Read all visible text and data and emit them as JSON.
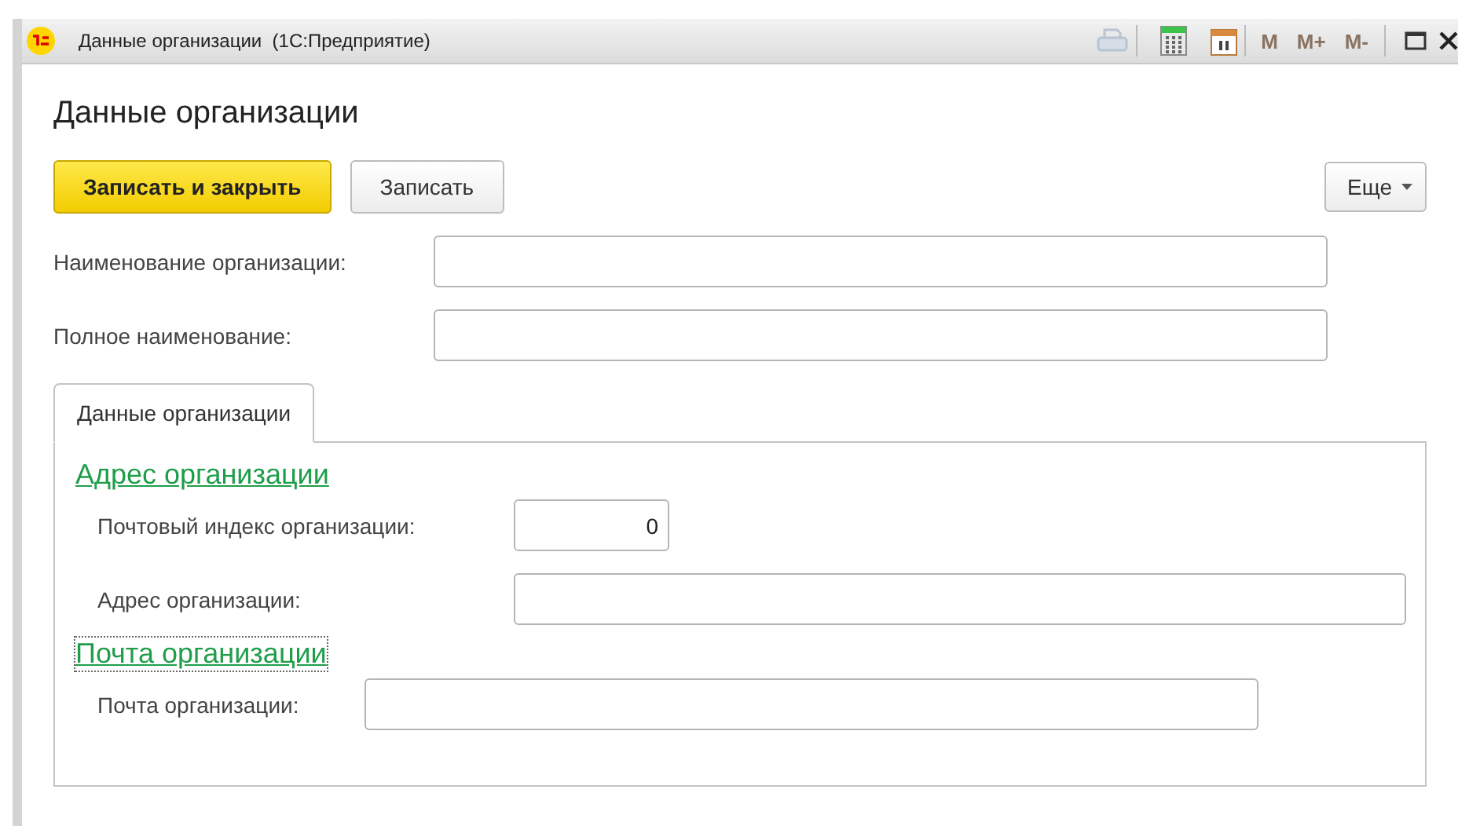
{
  "window": {
    "title": "Данные организации  (1С:Предприятие)",
    "memory_buttons": [
      "M",
      "M+",
      "M-"
    ]
  },
  "form_title": "Данные организации",
  "toolbar": {
    "buttons": [
      {
        "label": "Записать и закрыть",
        "kind": "primary"
      },
      {
        "label": "Записать",
        "kind": "plain"
      }
    ],
    "more": {
      "label": "Еще"
    }
  },
  "fields": [
    {
      "label": "Наименование организации:"
    },
    {
      "label": "Полное наименование:"
    }
  ],
  "tabs": [
    {
      "label": "Данные организации",
      "selected": true
    }
  ],
  "groups": [
    {
      "title": "Адрес организации",
      "focused": false,
      "fields": [
        {
          "label": "Почтовый индекс организации:",
          "value": "0",
          "kind": "number"
        },
        {
          "label": "Адрес организации:",
          "kind": "text"
        }
      ]
    },
    {
      "title": "Почта организации",
      "focused": true,
      "fields": [
        {
          "label": "Почта организации:",
          "kind": "text"
        }
      ]
    }
  ]
}
